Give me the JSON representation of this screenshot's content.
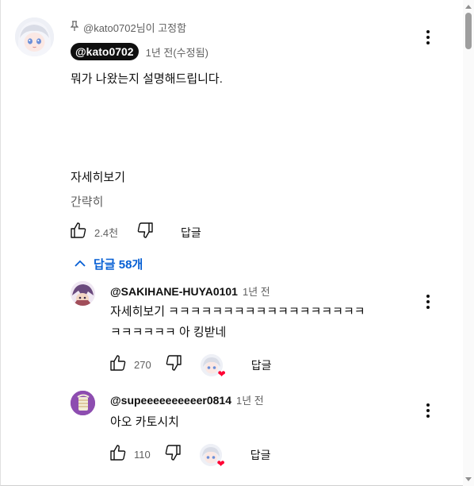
{
  "pinned_comment": {
    "pinned_by": "@kato0702님이 고정함",
    "author": "@kato0702",
    "time": "1년 전(수정됨)",
    "text": "뭐가 나왔는지 설명해드립니다.",
    "read_more": "자세히보기",
    "show_less": "간략히",
    "like_count": "2.4천",
    "reply_label": "답글",
    "replies_toggle": "답글 58개"
  },
  "replies": [
    {
      "author": "@SAKIHANE-HUYA0101",
      "time": "1년 전",
      "text_line1": "자세히보기 ㅋㅋㅋㅋㅋㅋㅋㅋㅋㅋㅋㅋㅋㅋㅋㅋㅋㅋ",
      "text_line2": "ㅋㅋㅋㅋㅋㅋ 아 킹받네",
      "like_count": "270",
      "reply_label": "답글"
    },
    {
      "author": "@supeeeeeeeeeer0814",
      "time": "1년 전",
      "text_line1": "아오 카토시치",
      "like_count": "110",
      "reply_label": "답글"
    }
  ],
  "icons": {
    "pin": "pin-icon",
    "like": "thumbs-up-icon",
    "dislike": "thumbs-down-icon",
    "more": "more-vert-icon",
    "chevron": "chevron-up-icon",
    "heart": "heart-icon"
  },
  "colors": {
    "link_blue": "#065fd4",
    "heart_red": "#ff0033",
    "text_secondary": "#606060"
  }
}
